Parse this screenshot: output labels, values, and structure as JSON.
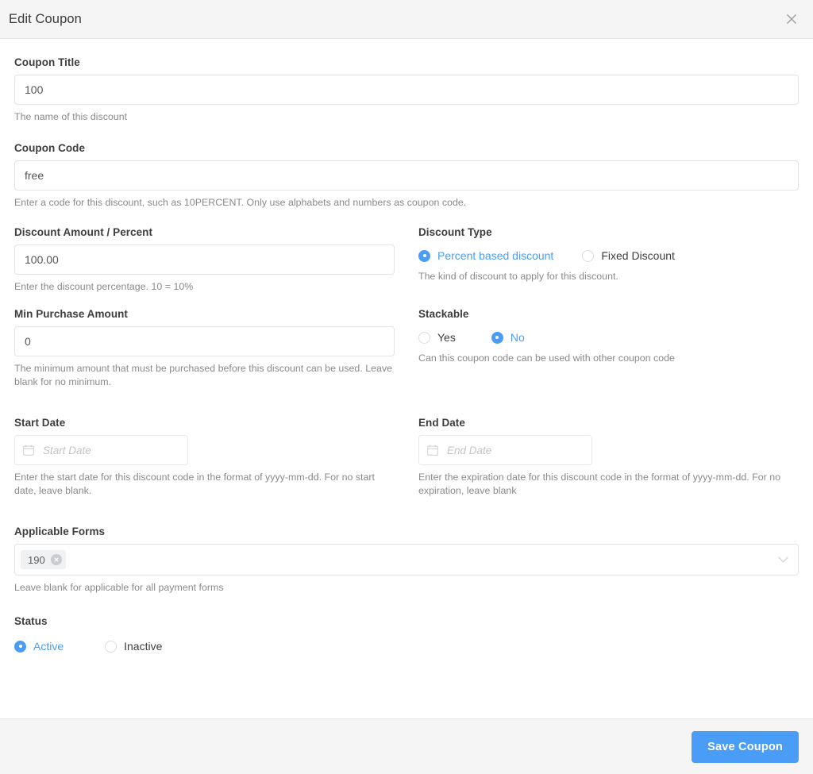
{
  "header": {
    "title": "Edit Coupon",
    "close_icon": "close-icon"
  },
  "fields": {
    "coupon_title": {
      "label": "Coupon Title",
      "value": "100",
      "help": "The name of this discount"
    },
    "coupon_code": {
      "label": "Coupon Code",
      "value": "free",
      "help": "Enter a code for this discount, such as 10PERCENT. Only use alphabets and numbers as coupon code."
    },
    "discount_amount": {
      "label": "Discount Amount / Percent",
      "value": "100.00",
      "help": "Enter the discount percentage. 10 = 10%"
    },
    "discount_type": {
      "label": "Discount Type",
      "help": "The kind of discount to apply for this discount.",
      "options": [
        {
          "label": "Percent based discount",
          "selected": true
        },
        {
          "label": "Fixed Discount",
          "selected": false
        }
      ]
    },
    "min_purchase": {
      "label": "Min Purchase Amount",
      "value": "0",
      "help": "The minimum amount that must be purchased before this discount can be used. Leave blank for no minimum."
    },
    "stackable": {
      "label": "Stackable",
      "help": "Can this coupon code can be used with other coupon code",
      "options": [
        {
          "label": "Yes",
          "selected": false
        },
        {
          "label": "No",
          "selected": true
        }
      ]
    },
    "start_date": {
      "label": "Start Date",
      "value": "",
      "placeholder": "Start Date",
      "icon": "calendar-icon",
      "help": "Enter the start date for this discount code in the format of yyyy-mm-dd. For no start date, leave blank."
    },
    "end_date": {
      "label": "End Date",
      "value": "",
      "placeholder": "End Date",
      "icon": "calendar-icon",
      "help": "Enter the expiration date for this discount code in the format of yyyy-mm-dd. For no expiration, leave blank"
    },
    "applicable_forms": {
      "label": "Applicable Forms",
      "tags": [
        "190"
      ],
      "help": "Leave blank for applicable for all payment forms",
      "dropdown_icon": "chevron-down-icon"
    },
    "status": {
      "label": "Status",
      "options": [
        {
          "label": "Active",
          "selected": true
        },
        {
          "label": "Inactive",
          "selected": false
        }
      ]
    }
  },
  "footer": {
    "save_label": "Save Coupon"
  },
  "colors": {
    "accent": "#4a9df7",
    "header_bg": "#f5f5f5",
    "border": "#e3e3e3",
    "label_text": "#3d3d3d",
    "help_text": "#8a8a8a"
  }
}
